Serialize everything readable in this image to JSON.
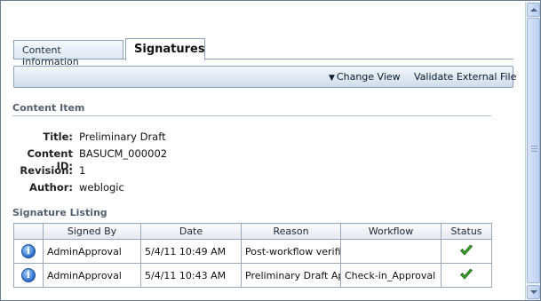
{
  "tabs": [
    {
      "label": "Content Information",
      "active": false
    },
    {
      "label": "Signatures",
      "active": true
    }
  ],
  "toolbar": {
    "change_view_label": "Change View",
    "validate_label": "Validate External File"
  },
  "content_item": {
    "section_title": "Content Item",
    "fields": [
      {
        "label": "Title:",
        "value": "Preliminary Draft"
      },
      {
        "label": "Content ID:",
        "value": "BASUCM_000002"
      },
      {
        "label": "Revision:",
        "value": "1"
      },
      {
        "label": "Author:",
        "value": "weblogic"
      }
    ]
  },
  "signature_listing": {
    "section_title": "Signature Listing",
    "columns": [
      "",
      "Signed By",
      "Date",
      "Reason",
      "Workflow",
      "Status"
    ],
    "rows": [
      {
        "icon": "info-icon",
        "signed_by": "AdminApproval",
        "date": "5/4/11 10:49 AM",
        "reason": "Post-workflow verific",
        "workflow": "",
        "status": "check-icon"
      },
      {
        "icon": "info-icon",
        "signed_by": "AdminApproval",
        "date": "5/4/11 10:43 AM",
        "reason": "Preliminary Draft App",
        "workflow": "Check-in_Approval",
        "status": "check-icon"
      }
    ]
  },
  "colors": {
    "accent": "#8aa2bc",
    "section_header": "#53606e",
    "check": "#3aa12a",
    "info": "#2a6bc7"
  }
}
